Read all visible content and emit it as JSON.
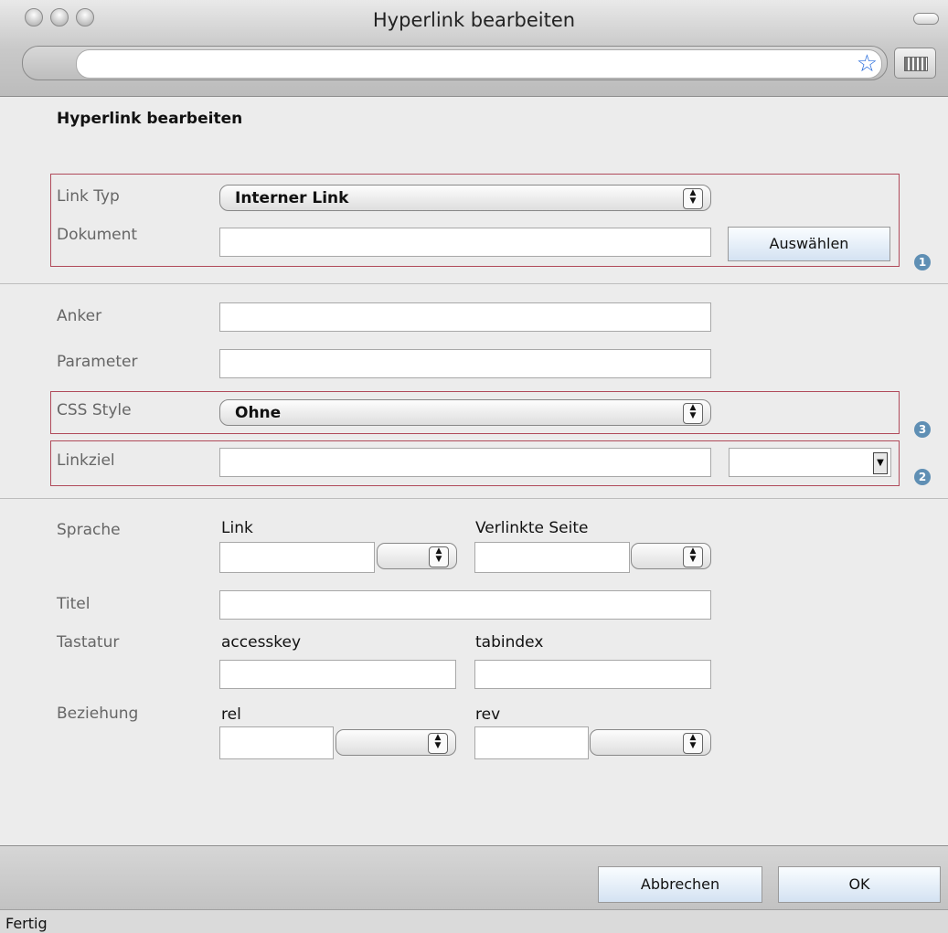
{
  "window": {
    "title": "Hyperlink bearbeiten"
  },
  "heading": "Hyperlink bearbeiten",
  "section1": {
    "link_type_label": "Link Typ",
    "link_type_value": "Interner Link",
    "document_label": "Dokument",
    "document_value": "",
    "select_button": "Auswählen",
    "badge": "1"
  },
  "section2": {
    "anchor_label": "Anker",
    "anchor_value": "",
    "parameter_label": "Parameter",
    "parameter_value": "",
    "css_label": "CSS Style",
    "css_value": "Ohne",
    "css_badge": "3",
    "target_label": "Linkziel",
    "target_value": "",
    "target_badge": "2"
  },
  "section3": {
    "language_label": "Sprache",
    "link_label": "Link",
    "linked_page_label": "Verlinkte Seite",
    "title_label": "Titel",
    "title_value": "",
    "keyboard_label": "Tastatur",
    "accesskey_label": "accesskey",
    "tabindex_label": "tabindex",
    "relation_label": "Beziehung",
    "rel_label": "rel",
    "rev_label": "rev"
  },
  "footer": {
    "cancel": "Abbrechen",
    "ok": "OK"
  },
  "statusbar": {
    "text": "Fertig"
  }
}
